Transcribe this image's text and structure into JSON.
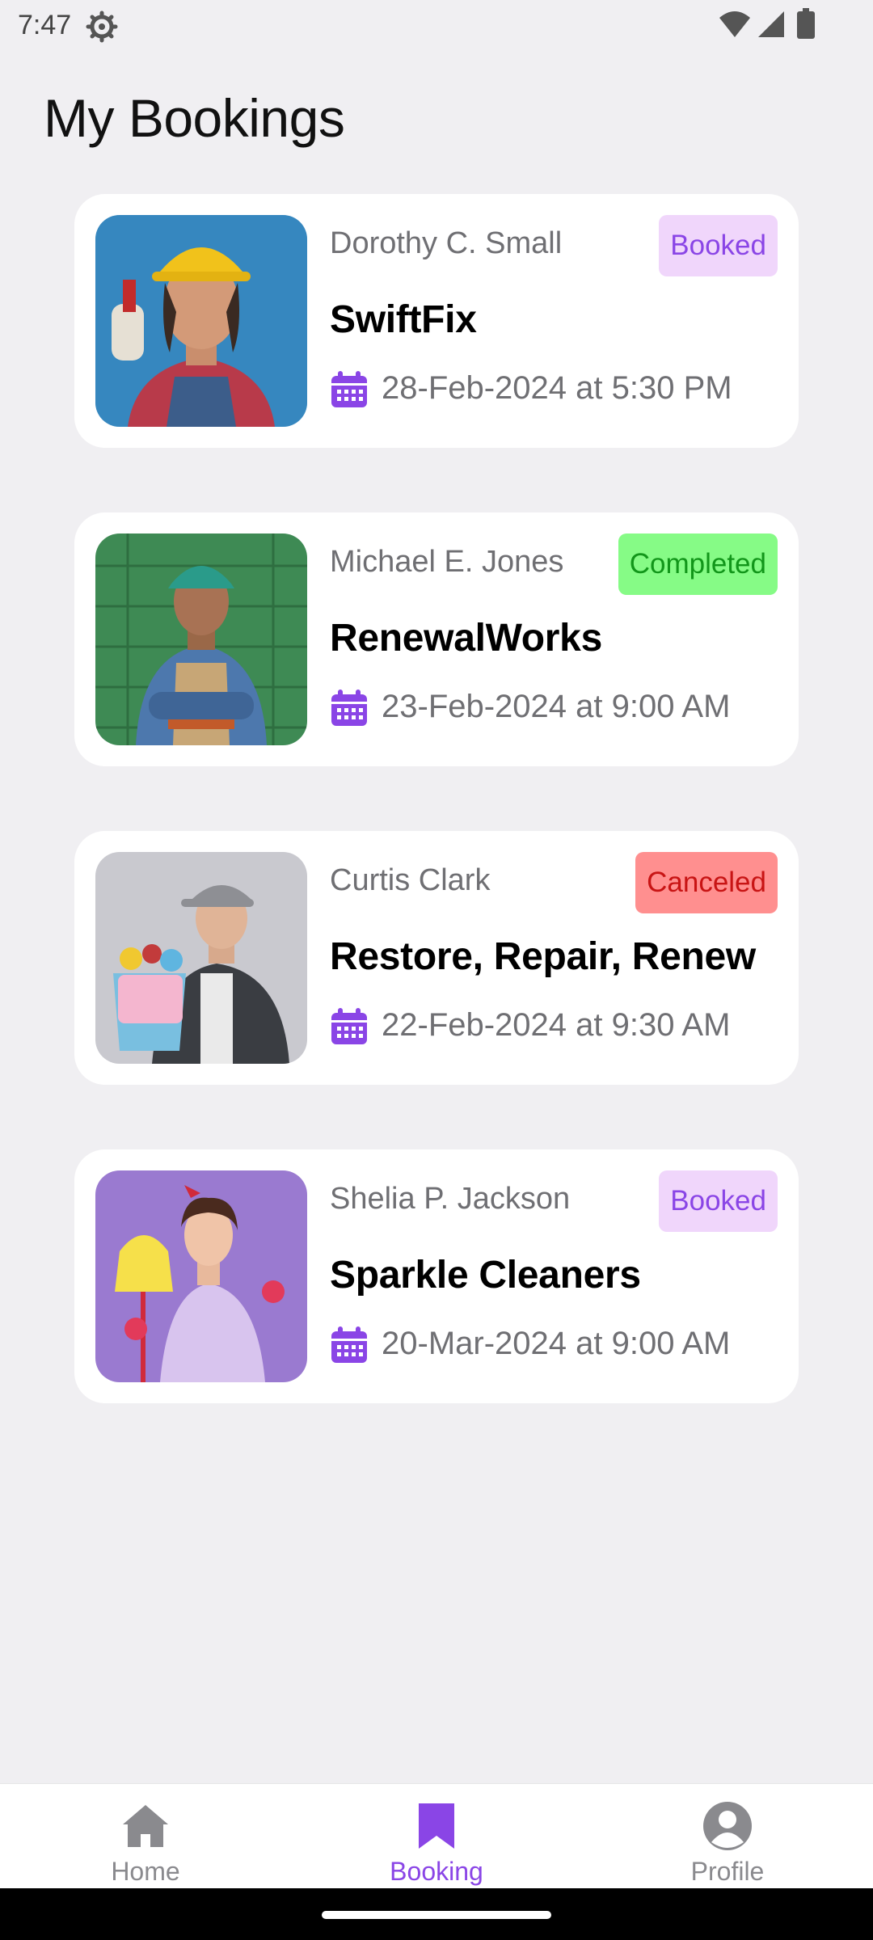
{
  "status_bar": {
    "time": "7:47",
    "icons": [
      "gear-icon",
      "wifi-icon",
      "signal-icon",
      "battery-icon"
    ]
  },
  "page": {
    "title": "My Bookings"
  },
  "colors": {
    "accent": "#8a45e6",
    "booked_bg": "#f0d6fb",
    "completed_bg": "#86fb86",
    "completed_text": "#12961a",
    "canceled_bg": "#ff8f8f",
    "canceled_text": "#c81414"
  },
  "bookings": [
    {
      "provider": "Dorothy C. Small",
      "business": "SwiftFix",
      "date": "28-Feb-2024 at 5:30 PM",
      "status": "Booked"
    },
    {
      "provider": "Michael E. Jones",
      "business": "RenewalWorks",
      "date": "23-Feb-2024 at 9:00 AM",
      "status": "Completed"
    },
    {
      "provider": "Curtis Clark",
      "business": "Restore, Repair, Renew",
      "date": "22-Feb-2024 at 9:30 AM",
      "status": "Canceled"
    },
    {
      "provider": "Shelia P. Jackson",
      "business": "Sparkle Cleaners",
      "date": "20-Mar-2024 at 9:00 AM",
      "status": "Booked"
    }
  ],
  "bottom_nav": {
    "items": [
      {
        "label": "Home",
        "icon": "home-icon",
        "active": false
      },
      {
        "label": "Booking",
        "icon": "bookmark-icon",
        "active": true
      },
      {
        "label": "Profile",
        "icon": "profile-icon",
        "active": false
      }
    ]
  }
}
